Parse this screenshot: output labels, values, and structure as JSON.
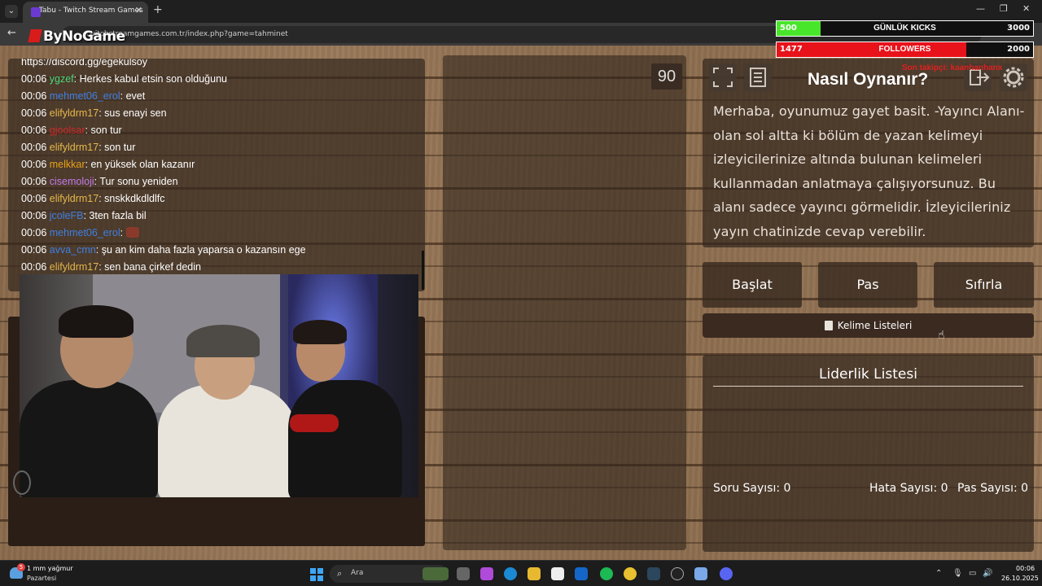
{
  "browser": {
    "tab_title": "Tabu - Twitch Stream Games",
    "url": "twitchstreamgames.com.tr/index.php?game=tahminet"
  },
  "overlay": {
    "logo": "ByNoGame",
    "kicks": {
      "current": "500",
      "label": "GÜNLÜK KICKS",
      "goal": "3000",
      "progress": 0.17,
      "color": "#48e62a"
    },
    "followers": {
      "current": "1477",
      "label": "FOLLOWERS",
      "goal": "2000",
      "progress": 0.74,
      "color": "#e8121a"
    },
    "subtitle": "Son takipçi: kaanhanhanx"
  },
  "chat": {
    "top_line": "https://discord.gg/egekulsoy",
    "messages": [
      {
        "time": "00:06",
        "user": "ygzef",
        "color": "#4cd97b",
        "text": "Herkes kabul etsin son olduğunu"
      },
      {
        "time": "00:06",
        "user": "mehmet06_erol",
        "color": "#3f7fe0",
        "text": "evet"
      },
      {
        "time": "00:06",
        "user": "elifyldrm17",
        "color": "#e6b84a",
        "text": "sus enayi sen"
      },
      {
        "time": "00:06",
        "user": "gjoolsar",
        "color": "#d12a2a",
        "text": "son tur"
      },
      {
        "time": "00:06",
        "user": "elifyldrm17",
        "color": "#e6b84a",
        "text": "son tur"
      },
      {
        "time": "00:06",
        "user": "melkkar",
        "color": "#e8a11a",
        "text": "en yüksek olan kazanır"
      },
      {
        "time": "00:06",
        "user": "cisemoloji",
        "color": "#c07ae8",
        "text": "Tur sonu yeniden"
      },
      {
        "time": "00:06",
        "user": "elifyldrm17",
        "color": "#e6b84a",
        "text": "snskkdkdldlfc"
      },
      {
        "time": "00:06",
        "user": "jcoleFB",
        "color": "#3f7fe0",
        "text": "3ten fazla bil"
      },
      {
        "time": "00:06",
        "user": "mehmet06_erol",
        "color": "#3f7fe0",
        "text": ""
      },
      {
        "time": "00:06",
        "user": "avva_cmn",
        "color": "#3f7fe0",
        "text": "şu an kim daha fazla yaparsa o kazansın ege"
      },
      {
        "time": "00:06",
        "user": "elifyldrm17",
        "color": "#e6b84a",
        "text": "sen bana çirkef dedin"
      }
    ]
  },
  "game": {
    "timer": "90",
    "howto_title": "Nasıl Oynanır?",
    "howto_text": "Merhaba, oyunumuz gayet basit. -Yayıncı Alanı- olan sol altta ki bölüm de yazan kelimeyi izleyicilerinize altında bulunan kelimeleri kullanmadan anlatmaya çalışıyorsunuz. Bu alanı sadece yayıncı görmelidir. İzleyicileriniz yayın chatinizde cevap verebilir.",
    "buttons": {
      "start": "Başlat",
      "pass": "Pas",
      "reset": "Sıfırla"
    },
    "word_lists": "Kelime Listeleri",
    "leaderboard_title": "Liderlik Listesi",
    "stats": {
      "questions_label": "Soru Sayısı:",
      "questions": "0",
      "errors_label": "Hata Sayısı:",
      "errors": "0",
      "passes_label": "Pas Sayısı:",
      "passes": "0"
    }
  },
  "taskbar": {
    "weather_badge": "5",
    "weather_title": "1 mm yağmur",
    "weather_sub": "Pazartesi",
    "search_placeholder": "Ara",
    "time": "00:06",
    "date": "26.10.2025"
  }
}
